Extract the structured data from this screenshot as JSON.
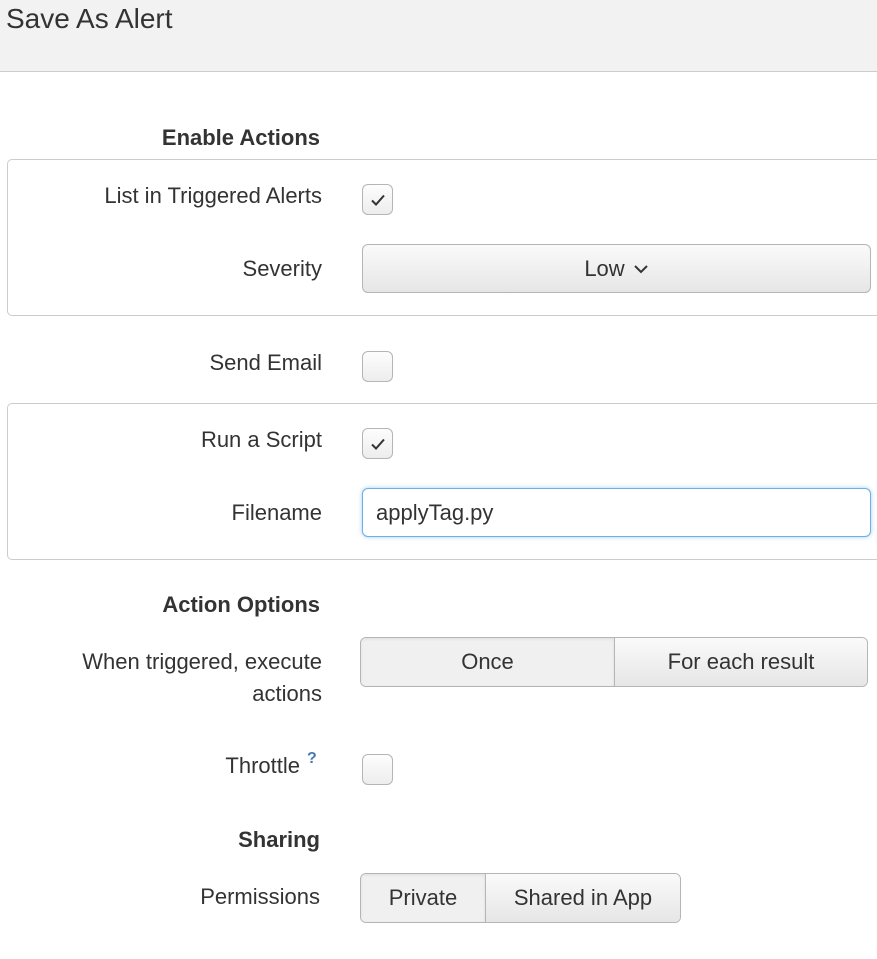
{
  "header": {
    "title": "Save As Alert"
  },
  "enable_actions": {
    "title": "Enable Actions",
    "list_in_triggered_alerts": {
      "label": "List in Triggered Alerts",
      "checked": true
    },
    "severity": {
      "label": "Severity",
      "value": "Low"
    },
    "send_email": {
      "label": "Send Email",
      "checked": false
    },
    "run_a_script": {
      "label": "Run a Script",
      "checked": true
    },
    "filename": {
      "label": "Filename",
      "value": "applyTag.py"
    }
  },
  "action_options": {
    "title": "Action Options",
    "when_triggered": {
      "label_line1": "When triggered, execute",
      "label_line2": "actions",
      "options": [
        "Once",
        "For each result"
      ],
      "selected": "Once"
    },
    "throttle": {
      "label": "Throttle",
      "help": "?",
      "checked": false
    }
  },
  "sharing": {
    "title": "Sharing",
    "permissions": {
      "label": "Permissions",
      "options": [
        "Private",
        "Shared in App"
      ],
      "selected": "Private"
    }
  },
  "icons": {
    "check": "check-icon",
    "chevron": "chevron-down-icon",
    "help": "question-icon"
  },
  "colors": {
    "focus_border": "#6cb0e8",
    "help": "#4a78b5",
    "header_bg": "#f2f2f2"
  }
}
